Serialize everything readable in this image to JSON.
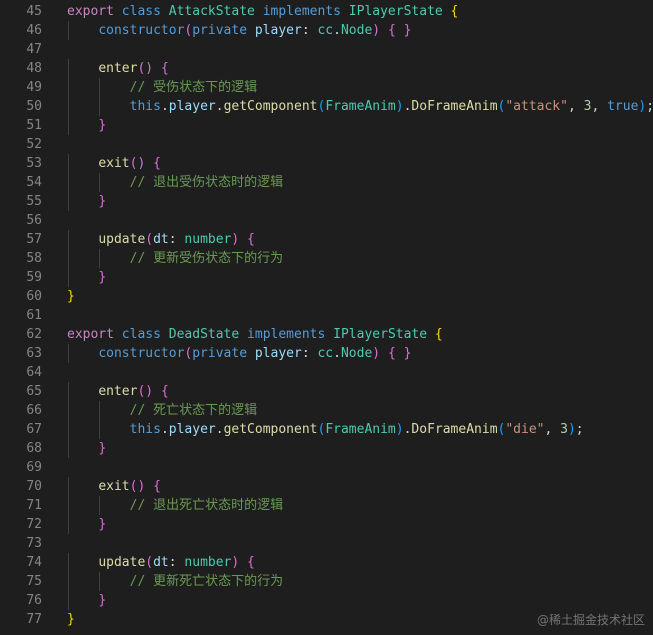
{
  "editor": {
    "lines": [
      {
        "n": "45",
        "code": [
          [
            "export",
            "kw-purple"
          ],
          [
            " "
          ],
          [
            "class",
            "kw-blue"
          ],
          [
            " "
          ],
          [
            "AttackState",
            "type"
          ],
          [
            " "
          ],
          [
            "implements",
            "kw-blue"
          ],
          [
            " "
          ],
          [
            "IPlayerState",
            "type"
          ],
          [
            " "
          ],
          [
            "{",
            "b1"
          ]
        ]
      },
      {
        "n": "46",
        "code": [
          [
            "    "
          ],
          [
            "constructor",
            "kw-blue"
          ],
          [
            "(",
            "b2"
          ],
          [
            "private",
            "kw-blue"
          ],
          [
            " "
          ],
          [
            "player",
            "var"
          ],
          [
            ": "
          ],
          [
            "cc",
            "type"
          ],
          [
            "."
          ],
          [
            "Node",
            "type"
          ],
          [
            ")",
            "b2"
          ],
          [
            " "
          ],
          [
            "{",
            "b2"
          ],
          [
            " "
          ],
          [
            "}",
            "b2"
          ]
        ]
      },
      {
        "n": "47",
        "code": []
      },
      {
        "n": "48",
        "code": [
          [
            "    "
          ],
          [
            "enter",
            "func"
          ],
          [
            "()",
            "b2"
          ],
          [
            " "
          ],
          [
            "{",
            "b2"
          ]
        ]
      },
      {
        "n": "49",
        "code": [
          [
            "        "
          ],
          [
            "// 受伤状态下的逻辑",
            "cmt"
          ]
        ]
      },
      {
        "n": "50",
        "code": [
          [
            "        "
          ],
          [
            "this",
            "kw-blue"
          ],
          [
            "."
          ],
          [
            "player",
            "var"
          ],
          [
            "."
          ],
          [
            "getComponent",
            "func"
          ],
          [
            "(",
            "b3"
          ],
          [
            "FrameAnim",
            "type"
          ],
          [
            ")",
            "b3"
          ],
          [
            "."
          ],
          [
            "DoFrameAnim",
            "func"
          ],
          [
            "(",
            "b3"
          ],
          [
            "\"attack\"",
            "str"
          ],
          [
            ", "
          ],
          [
            "3",
            "num"
          ],
          [
            ", "
          ],
          [
            "true",
            "kw-blue"
          ],
          [
            ")",
            "b3"
          ],
          [
            ";"
          ]
        ]
      },
      {
        "n": "51",
        "code": [
          [
            "    "
          ],
          [
            "}",
            "b2"
          ]
        ]
      },
      {
        "n": "52",
        "code": []
      },
      {
        "n": "53",
        "code": [
          [
            "    "
          ],
          [
            "exit",
            "func"
          ],
          [
            "()",
            "b2"
          ],
          [
            " "
          ],
          [
            "{",
            "b2"
          ]
        ]
      },
      {
        "n": "54",
        "code": [
          [
            "        "
          ],
          [
            "// 退出受伤状态时的逻辑",
            "cmt"
          ]
        ]
      },
      {
        "n": "55",
        "code": [
          [
            "    "
          ],
          [
            "}",
            "b2"
          ]
        ]
      },
      {
        "n": "56",
        "code": []
      },
      {
        "n": "57",
        "code": [
          [
            "    "
          ],
          [
            "update",
            "func"
          ],
          [
            "(",
            "b2"
          ],
          [
            "dt",
            "var"
          ],
          [
            ": "
          ],
          [
            "number",
            "type"
          ],
          [
            ")",
            "b2"
          ],
          [
            " "
          ],
          [
            "{",
            "b2"
          ]
        ]
      },
      {
        "n": "58",
        "code": [
          [
            "        "
          ],
          [
            "// 更新受伤状态下的行为",
            "cmt"
          ]
        ]
      },
      {
        "n": "59",
        "code": [
          [
            "    "
          ],
          [
            "}",
            "b2"
          ]
        ]
      },
      {
        "n": "60",
        "code": [
          [
            "}",
            "b1"
          ]
        ]
      },
      {
        "n": "61",
        "code": []
      },
      {
        "n": "62",
        "code": [
          [
            "export",
            "kw-purple"
          ],
          [
            " "
          ],
          [
            "class",
            "kw-blue"
          ],
          [
            " "
          ],
          [
            "DeadState",
            "type"
          ],
          [
            " "
          ],
          [
            "implements",
            "kw-blue"
          ],
          [
            " "
          ],
          [
            "IPlayerState",
            "type"
          ],
          [
            " "
          ],
          [
            "{",
            "b1"
          ]
        ]
      },
      {
        "n": "63",
        "code": [
          [
            "    "
          ],
          [
            "constructor",
            "kw-blue"
          ],
          [
            "(",
            "b2"
          ],
          [
            "private",
            "kw-blue"
          ],
          [
            " "
          ],
          [
            "player",
            "var"
          ],
          [
            ": "
          ],
          [
            "cc",
            "type"
          ],
          [
            "."
          ],
          [
            "Node",
            "type"
          ],
          [
            ")",
            "b2"
          ],
          [
            " "
          ],
          [
            "{",
            "b2"
          ],
          [
            " "
          ],
          [
            "}",
            "b2"
          ]
        ]
      },
      {
        "n": "64",
        "code": []
      },
      {
        "n": "65",
        "code": [
          [
            "    "
          ],
          [
            "enter",
            "func"
          ],
          [
            "()",
            "b2"
          ],
          [
            " "
          ],
          [
            "{",
            "b2"
          ]
        ]
      },
      {
        "n": "66",
        "code": [
          [
            "        "
          ],
          [
            "// 死亡状态下的逻辑",
            "cmt"
          ]
        ]
      },
      {
        "n": "67",
        "code": [
          [
            "        "
          ],
          [
            "this",
            "kw-blue"
          ],
          [
            "."
          ],
          [
            "player",
            "var"
          ],
          [
            "."
          ],
          [
            "getComponent",
            "func"
          ],
          [
            "(",
            "b3"
          ],
          [
            "FrameAnim",
            "type"
          ],
          [
            ")",
            "b3"
          ],
          [
            "."
          ],
          [
            "DoFrameAnim",
            "func"
          ],
          [
            "(",
            "b3"
          ],
          [
            "\"die\"",
            "str"
          ],
          [
            ", "
          ],
          [
            "3",
            "num"
          ],
          [
            ")",
            "b3"
          ],
          [
            ";"
          ]
        ]
      },
      {
        "n": "68",
        "code": [
          [
            "    "
          ],
          [
            "}",
            "b2"
          ]
        ]
      },
      {
        "n": "69",
        "code": []
      },
      {
        "n": "70",
        "code": [
          [
            "    "
          ],
          [
            "exit",
            "func"
          ],
          [
            "()",
            "b2"
          ],
          [
            " "
          ],
          [
            "{",
            "b2"
          ]
        ]
      },
      {
        "n": "71",
        "code": [
          [
            "        "
          ],
          [
            "// 退出死亡状态时的逻辑",
            "cmt"
          ]
        ]
      },
      {
        "n": "72",
        "code": [
          [
            "    "
          ],
          [
            "}",
            "b2"
          ]
        ]
      },
      {
        "n": "73",
        "code": []
      },
      {
        "n": "74",
        "code": [
          [
            "    "
          ],
          [
            "update",
            "func"
          ],
          [
            "(",
            "b2"
          ],
          [
            "dt",
            "var"
          ],
          [
            ": "
          ],
          [
            "number",
            "type"
          ],
          [
            ")",
            "b2"
          ],
          [
            " "
          ],
          [
            "{",
            "b2"
          ]
        ]
      },
      {
        "n": "75",
        "code": [
          [
            "        "
          ],
          [
            "// 更新死亡状态下的行为",
            "cmt"
          ]
        ]
      },
      {
        "n": "76",
        "code": [
          [
            "    "
          ],
          [
            "}",
            "b2"
          ]
        ]
      },
      {
        "n": "77",
        "code": [
          [
            "}",
            "b1"
          ]
        ]
      }
    ]
  },
  "watermark": "@稀土掘金技术社区",
  "colors": {
    "background": "#1e1e1e",
    "gutter": "#858585",
    "comment": "#6a9955",
    "keyword": "#569cd6",
    "control": "#c586c0",
    "type": "#4ec9b0",
    "function": "#dcdcaa",
    "string": "#ce9178"
  }
}
